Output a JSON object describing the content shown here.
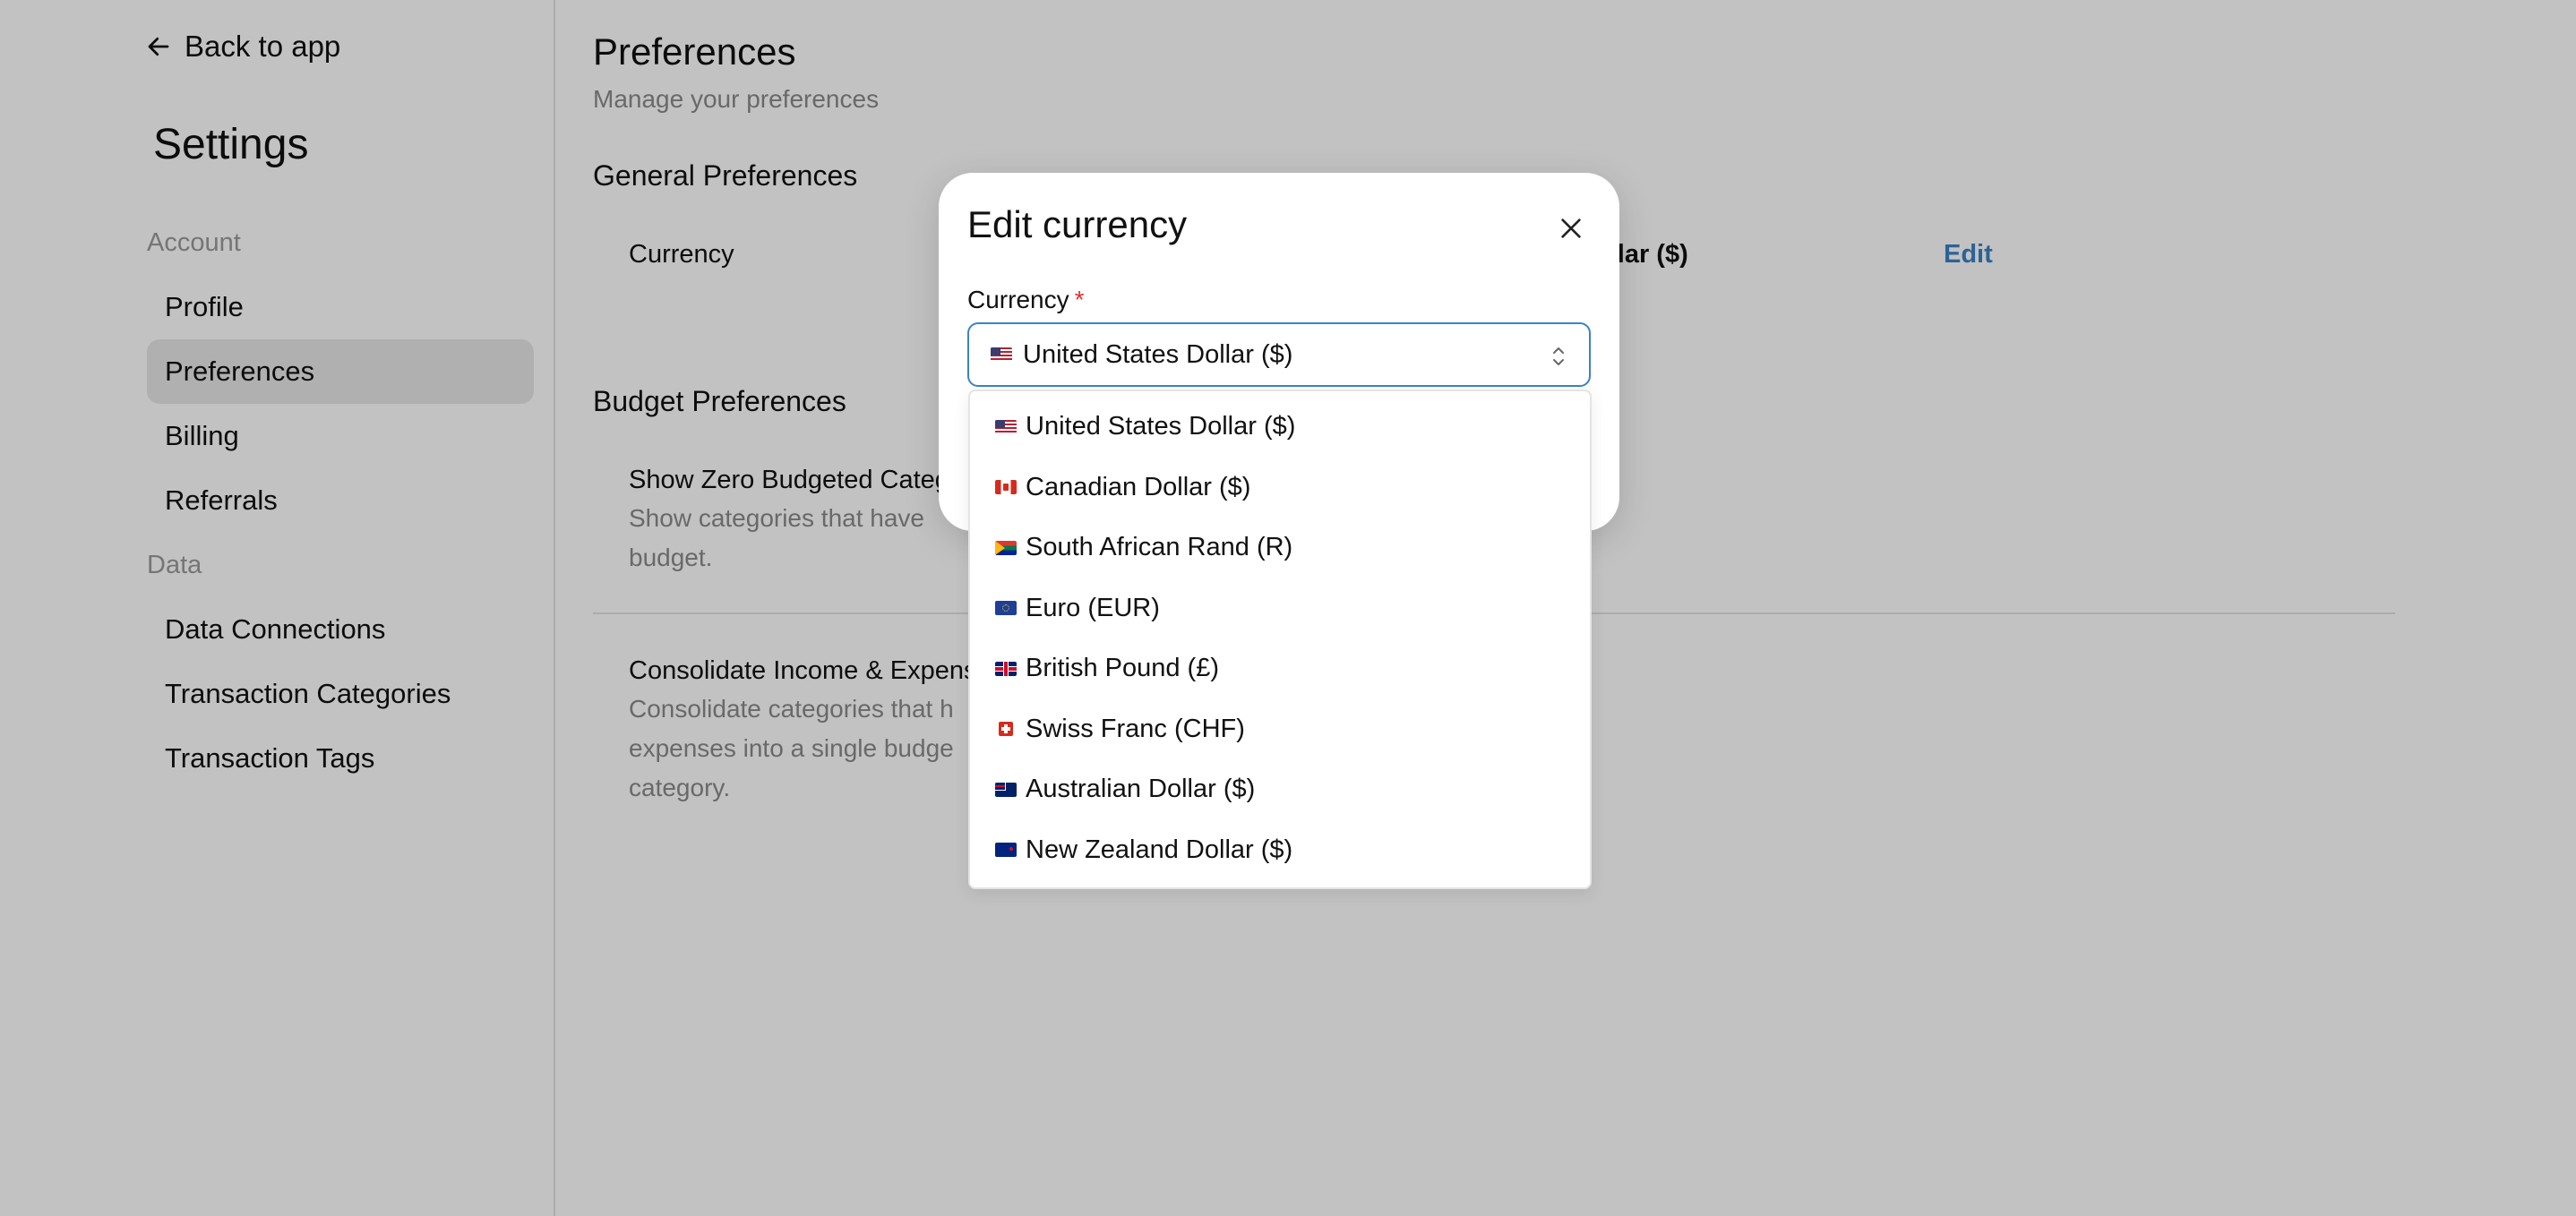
{
  "sidebar": {
    "back_label": "Back to app",
    "title": "Settings",
    "sections": [
      {
        "label": "Account"
      },
      {
        "label": "Data"
      }
    ],
    "items": [
      {
        "label": "Profile"
      },
      {
        "label": "Preferences",
        "active": true
      },
      {
        "label": "Billing"
      },
      {
        "label": "Referrals"
      },
      {
        "label": "Data Connections"
      },
      {
        "label": "Transaction Categories"
      },
      {
        "label": "Transaction Tags"
      }
    ]
  },
  "main": {
    "title": "Preferences",
    "subtitle": "Manage your preferences",
    "general": {
      "title": "General Preferences",
      "currency_label": "Currency",
      "currency_value_visible": "ollar ($)",
      "edit_label": "Edit"
    },
    "budget": {
      "title": "Budget Preferences",
      "zero_label_visible": "Show Zero Budgeted Categ",
      "zero_desc_visible": "Show categories that have",
      "zero_desc_line2": "budget.",
      "consolidate_label_visible": "Consolidate Income & Expens",
      "consolidate_desc_line1": "Consolidate categories that h",
      "consolidate_desc_line2": "expenses into a single budge",
      "consolidate_desc_line3": "category."
    }
  },
  "modal": {
    "title": "Edit currency",
    "field_label": "Currency",
    "required_mark": "*",
    "selected_value": "United States Dollar ($)",
    "options": [
      {
        "label": "United States Dollar ($)",
        "flag": "us-flag-icon"
      },
      {
        "label": "Canadian Dollar ($)",
        "flag": "ca-flag-icon"
      },
      {
        "label": "South African Rand (R)",
        "flag": "za-flag-icon"
      },
      {
        "label": "Euro (EUR)",
        "flag": "eu-flag-icon"
      },
      {
        "label": "British Pound (£)",
        "flag": "gb-flag-icon"
      },
      {
        "label": "Swiss Franc (CHF)",
        "flag": "ch-flag-icon"
      },
      {
        "label": "Australian Dollar ($)",
        "flag": "au-flag-icon"
      },
      {
        "label": "New Zealand Dollar ($)",
        "flag": "nz-flag-icon"
      }
    ]
  },
  "colors": {
    "accent": "#3b82c6",
    "required": "#e03131",
    "active_nav_bg": "#e8e8e8",
    "muted_text": "#8a8a8a"
  }
}
